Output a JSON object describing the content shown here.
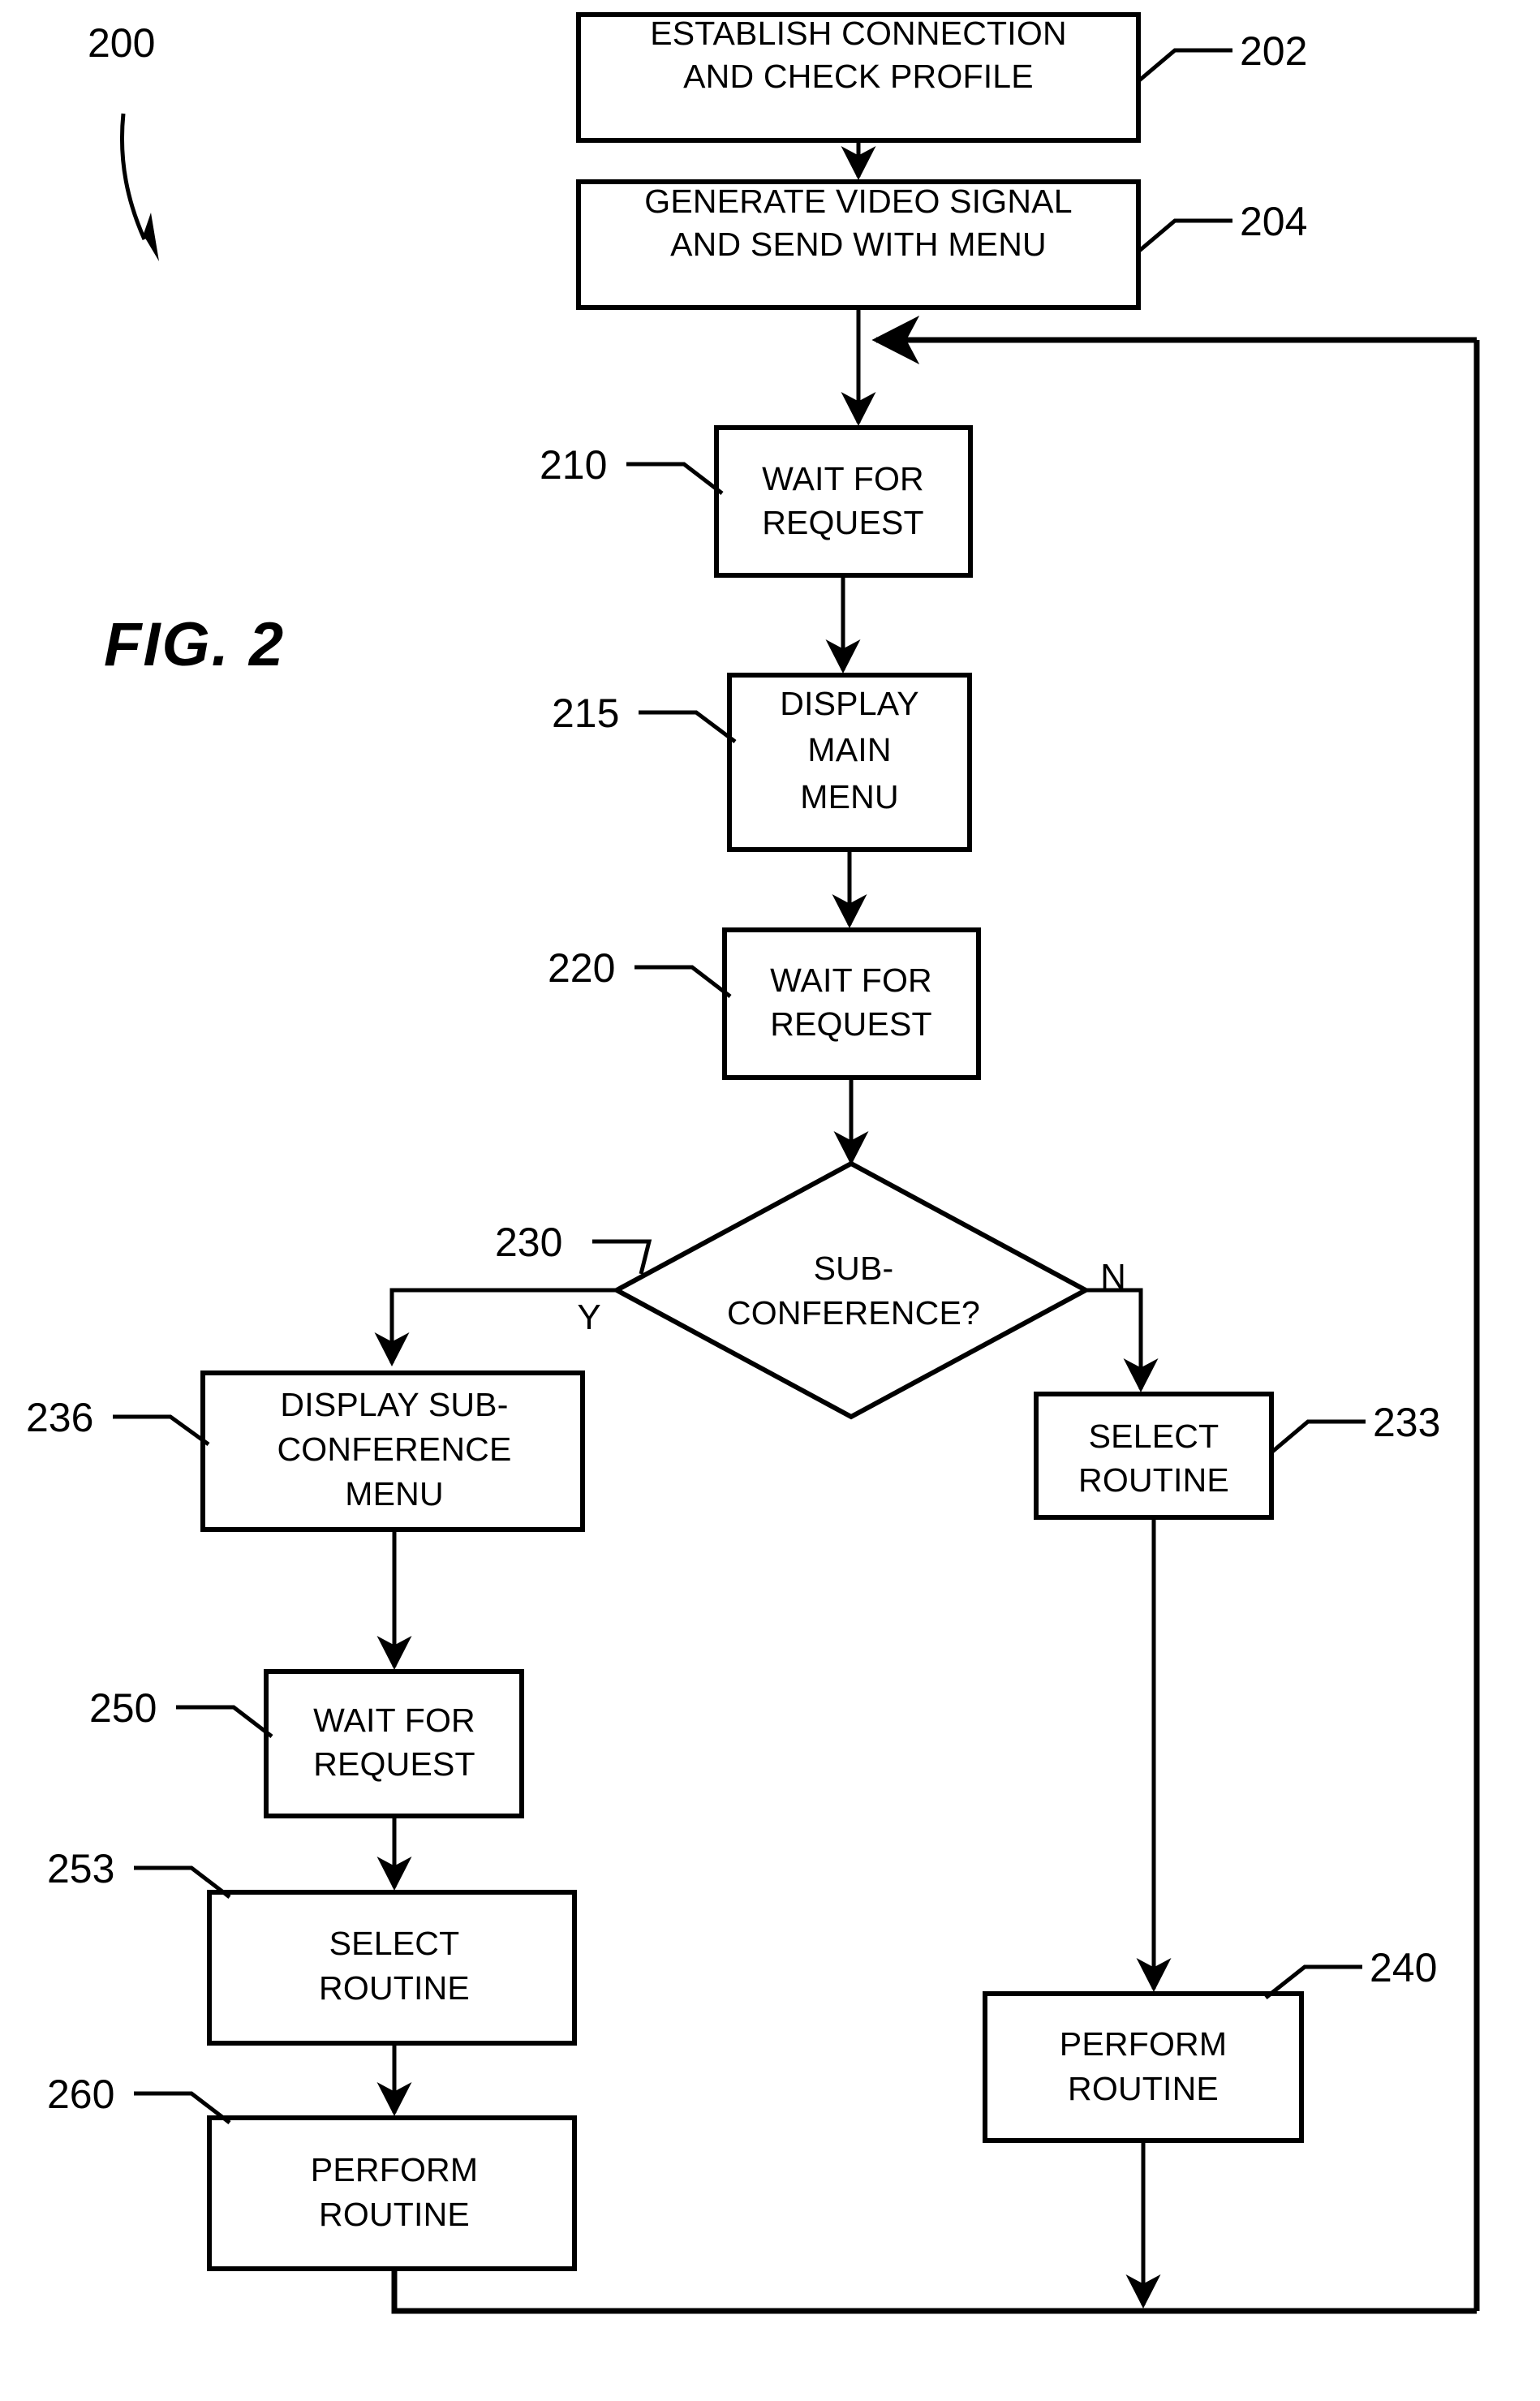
{
  "figure": {
    "label": "FIG. 2",
    "diagram_number": "200"
  },
  "nodes": [
    {
      "ref": "202",
      "type": "process",
      "lines": [
        "ESTABLISH CONNECTION",
        "AND CHECK PROFILE"
      ]
    },
    {
      "ref": "204",
      "type": "process",
      "lines": [
        "GENERATE VIDEO SIGNAL",
        "AND SEND WITH MENU"
      ]
    },
    {
      "ref": "210",
      "type": "process",
      "lines": [
        "WAIT FOR",
        "REQUEST"
      ]
    },
    {
      "ref": "215",
      "type": "process",
      "lines": [
        "DISPLAY",
        "MAIN",
        "MENU"
      ]
    },
    {
      "ref": "220",
      "type": "process",
      "lines": [
        "WAIT FOR",
        "REQUEST"
      ]
    },
    {
      "ref": "230",
      "type": "decision",
      "lines": [
        "SUB-",
        "CONFERENCE?"
      ]
    },
    {
      "ref": "233",
      "type": "process",
      "lines": [
        "SELECT",
        "ROUTINE"
      ]
    },
    {
      "ref": "236",
      "type": "process",
      "lines": [
        "DISPLAY SUB-",
        "CONFERENCE",
        "MENU"
      ]
    },
    {
      "ref": "240",
      "type": "process",
      "lines": [
        "PERFORM",
        "ROUTINE"
      ]
    },
    {
      "ref": "250",
      "type": "process",
      "lines": [
        "WAIT FOR",
        "REQUEST"
      ]
    },
    {
      "ref": "253",
      "type": "process",
      "lines": [
        "SELECT",
        "ROUTINE"
      ]
    },
    {
      "ref": "260",
      "type": "process",
      "lines": [
        "PERFORM",
        "ROUTINE"
      ]
    }
  ],
  "branch_labels": {
    "yes": "Y",
    "no": "N"
  },
  "colors": {
    "ink": "#000000",
    "paper": "#ffffff"
  }
}
